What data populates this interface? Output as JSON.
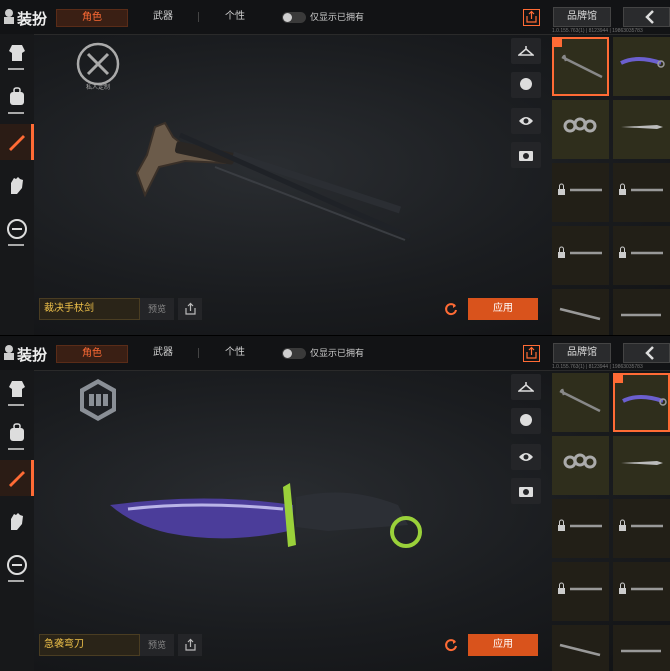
{
  "header": {
    "title": "装扮",
    "tabs": [
      {
        "label": "角色"
      },
      {
        "label": "武器"
      },
      {
        "label": "个性"
      }
    ],
    "toggle_label": "仅显示已拥有",
    "brand_button": "品牌馆",
    "version_text": "1.0.155.763(1) | 8123944 | 19863035783"
  },
  "colors": {
    "accent": "#ff6b35",
    "apply": "#d9531c",
    "name_text": "#f0c24a"
  },
  "sidebar_icons": [
    "outfit-icon",
    "backpack-icon",
    "knife-icon",
    "glove-icon",
    "link-icon"
  ],
  "tools": [
    "coat-hanger-icon",
    "head-icon",
    "eye-icon",
    "camera-icon"
  ],
  "panels": [
    {
      "emblem_caption": "私人定制",
      "emblem_icon": "crossed-tools-emblem-icon",
      "item_name": "裁决手杖剑",
      "preview_label": "预览",
      "apply_label": "应用",
      "weapon_icon": "cane-sword-icon",
      "selected_cell": 0
    },
    {
      "emblem_caption": "",
      "emblem_icon": "hexagon-emblem-icon",
      "item_name": "急袭弯刀",
      "preview_label": "预览",
      "apply_label": "应用",
      "weapon_icon": "karambit-icon",
      "selected_cell": 1
    }
  ],
  "grid_items": [
    "cane-sword-thumb-icon",
    "karambit-thumb-icon",
    "knuckles-thumb-icon",
    "dagger-thumb-icon",
    "locked-knife-thumb-icon",
    "locked-knife-thumb-icon",
    "locked-knife-thumb-icon",
    "locked-knife-thumb-icon",
    "axe-thumb-icon",
    "knife-thumb-icon"
  ]
}
